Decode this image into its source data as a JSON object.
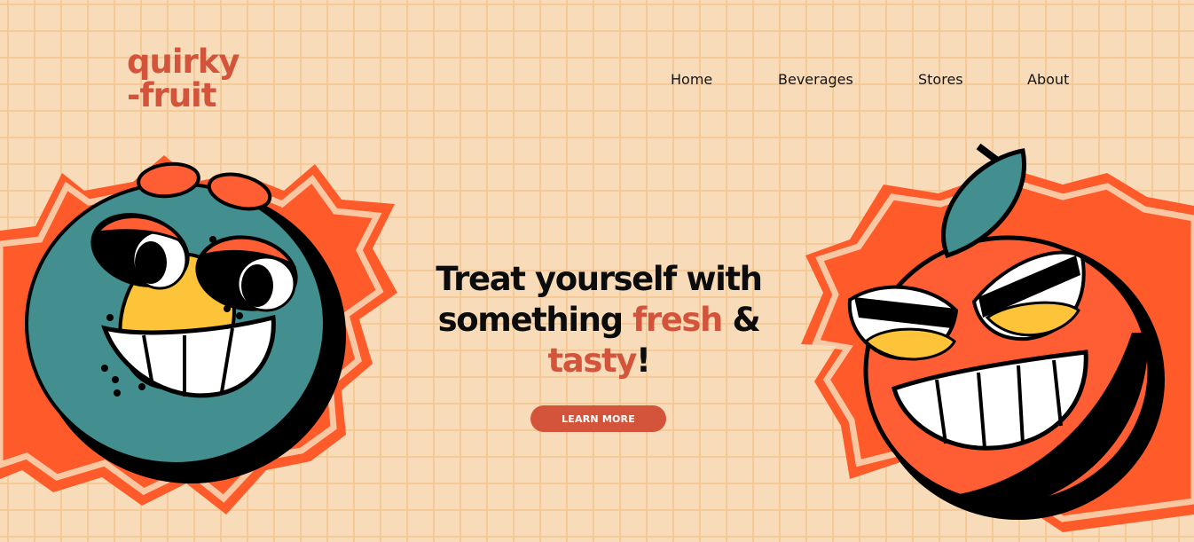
{
  "brand": {
    "line1": "quirky",
    "line2": "-fruit"
  },
  "nav": {
    "items": [
      {
        "label": "Home"
      },
      {
        "label": "Beverages"
      },
      {
        "label": "Stores"
      },
      {
        "label": "About"
      }
    ]
  },
  "hero": {
    "heading_part1": "Treat yourself with",
    "heading_part2": "something",
    "heading_accent1": "fresh",
    "heading_part3": "&",
    "heading_accent2": "tasty",
    "heading_part4": "!",
    "cta_label": "LEARN MORE"
  },
  "colors": {
    "background": "#f8dcb9",
    "grid": "#f4c48c",
    "accent": "#d3543a",
    "burst": "#ff5a2a",
    "teal": "#438e8e",
    "orange_fruit": "#ff5e35",
    "yellow": "#fdc43a",
    "text": "#0c0c0c"
  },
  "mascots": {
    "left": "teal-blueberry-mascot",
    "right": "orange-fruit-mascot"
  }
}
